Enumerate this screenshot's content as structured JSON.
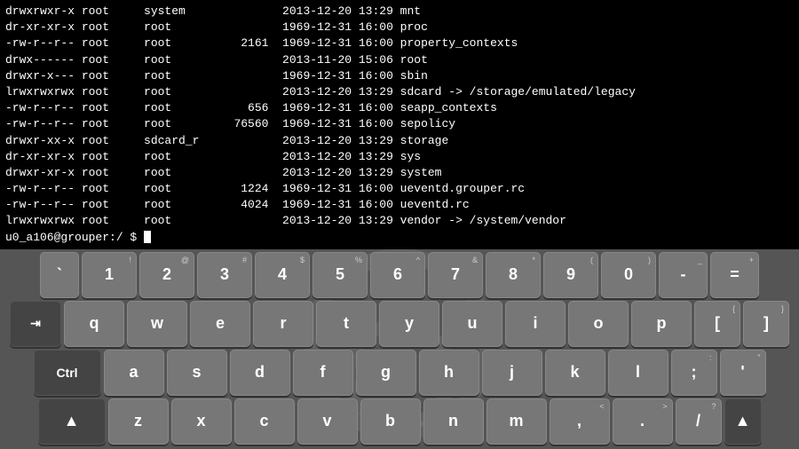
{
  "terminal": {
    "lines": [
      "drwxrwxr-x root     system              2013-12-20 13:29 mnt",
      "dr-xr-xr-x root     root                1969-12-31 16:00 proc",
      "-rw-r--r-- root     root          2161  1969-12-31 16:00 property_contexts",
      "drwx------ root     root                2013-11-20 15:06 root",
      "drwxr-x--- root     root                1969-12-31 16:00 sbin",
      "lrwxrwxrwx root     root                2013-12-20 13:29 sdcard -> /storage/emulated/legacy",
      "-rw-r--r-- root     root           656  1969-12-31 16:00 seapp_contexts",
      "-rw-r--r-- root     root         76560  1969-12-31 16:00 sepolicy",
      "drwxr-xx-x root     sdcard_r            2013-12-20 13:29 storage",
      "dr-xr-xr-x root     root                2013-12-20 13:29 sys",
      "drwxr-xr-x root     root                2013-12-20 13:29 system",
      "-rw-r--r-- root     root          1224  1969-12-31 16:00 ueventd.grouper.rc",
      "-rw-r--r-- root     root          4024  1969-12-31 16:00 ueventd.rc",
      "lrwxrwxrwx root     root                2013-12-20 13:29 vendor -> /system/vendor"
    ],
    "prompt": "u0_a106@grouper:/ $"
  },
  "keyboard": {
    "row1": [
      {
        "label": "`",
        "sub": "",
        "key": "backtick"
      },
      {
        "label": "1",
        "sub": "!",
        "key": "1"
      },
      {
        "label": "2",
        "sub": "@",
        "key": "2"
      },
      {
        "label": "3",
        "sub": "#",
        "key": "3"
      },
      {
        "label": "4",
        "sub": "$",
        "key": "4"
      },
      {
        "label": "5",
        "sub": "%",
        "key": "5"
      },
      {
        "label": "6",
        "sub": "^",
        "key": "6"
      },
      {
        "label": "7",
        "sub": "&",
        "key": "7"
      },
      {
        "label": "8",
        "sub": "*",
        "key": "8"
      },
      {
        "label": "9",
        "sub": "(",
        "key": "9"
      },
      {
        "label": "0",
        "sub": ")",
        "key": "0"
      },
      {
        "label": "-",
        "sub": "_",
        "key": "minus"
      },
      {
        "label": "=",
        "sub": "+",
        "key": "equals"
      }
    ],
    "row2": [
      {
        "label": "⇥",
        "sub": "",
        "key": "tab",
        "wide": true
      },
      {
        "label": "q",
        "sub": "",
        "key": "q"
      },
      {
        "label": "w",
        "sub": "",
        "key": "w"
      },
      {
        "label": "e",
        "sub": "",
        "key": "e"
      },
      {
        "label": "r",
        "sub": "",
        "key": "r"
      },
      {
        "label": "t",
        "sub": "",
        "key": "t"
      },
      {
        "label": "y",
        "sub": "",
        "key": "y"
      },
      {
        "label": "u",
        "sub": "",
        "key": "u"
      },
      {
        "label": "i",
        "sub": "",
        "key": "i"
      },
      {
        "label": "o",
        "sub": "",
        "key": "o"
      },
      {
        "label": "p",
        "sub": "",
        "key": "p"
      },
      {
        "label": "[",
        "sub": "{",
        "key": "lbracket"
      },
      {
        "label": "]",
        "sub": "}",
        "key": "rbracket"
      }
    ],
    "row3": [
      {
        "label": "Ctrl",
        "sub": "",
        "key": "ctrl",
        "wide": true
      },
      {
        "label": "a",
        "sub": "",
        "key": "a"
      },
      {
        "label": "s",
        "sub": "",
        "key": "s"
      },
      {
        "label": "d",
        "sub": "",
        "key": "d"
      },
      {
        "label": "f",
        "sub": "",
        "key": "f"
      },
      {
        "label": "g",
        "sub": "",
        "key": "g"
      },
      {
        "label": "h",
        "sub": "",
        "key": "h"
      },
      {
        "label": "j",
        "sub": "",
        "key": "j"
      },
      {
        "label": "k",
        "sub": "",
        "key": "k"
      },
      {
        "label": "l",
        "sub": "",
        "key": "l"
      },
      {
        "label": ";",
        "sub": ":",
        "key": "semicolon"
      },
      {
        "label": "'",
        "sub": "\"",
        "key": "quote"
      }
    ],
    "row4": [
      {
        "label": "▲",
        "sub": "",
        "key": "shift",
        "wide": true
      },
      {
        "label": "z",
        "sub": "",
        "key": "z"
      },
      {
        "label": "x",
        "sub": "",
        "key": "x"
      },
      {
        "label": "c",
        "sub": "",
        "key": "c"
      },
      {
        "label": "v",
        "sub": "",
        "key": "v"
      },
      {
        "label": "b",
        "sub": "",
        "key": "b"
      },
      {
        "label": "n",
        "sub": "",
        "key": "n"
      },
      {
        "label": "m",
        "sub": "",
        "key": "m"
      },
      {
        "label": ",",
        "sub": "<",
        "key": "comma"
      },
      {
        "label": ".",
        "sub": ">",
        "key": "period"
      },
      {
        "label": "/",
        "sub": "?",
        "key": "slash"
      },
      {
        "label": "▲",
        "sub": "",
        "key": "shift-right",
        "tri": true
      }
    ]
  }
}
